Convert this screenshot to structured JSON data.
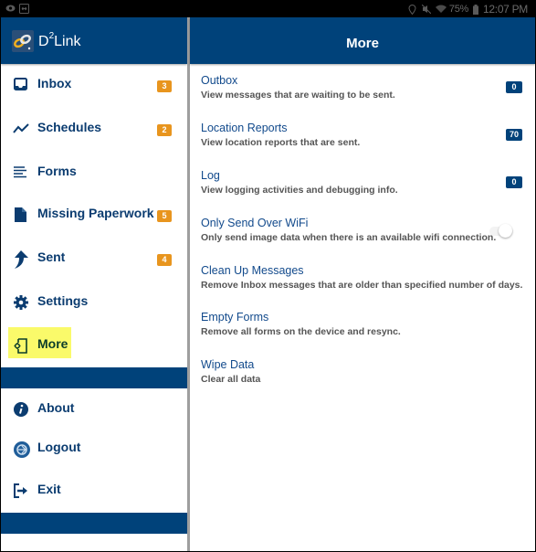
{
  "status_bar": {
    "left_icons": [
      "eye-icon",
      "screen-mirror-icon"
    ],
    "right_icons": [
      "location-icon",
      "mute-icon",
      "wifi-icon",
      "battery-icon"
    ],
    "battery": "75%",
    "time": "12:07 PM"
  },
  "app": {
    "name_prefix": "D",
    "name_sup": "2",
    "name_suffix": "Link"
  },
  "sidebar": {
    "items": [
      {
        "label": "Inbox",
        "icon": "inbox-icon",
        "badge": "3"
      },
      {
        "label": "Schedules",
        "icon": "trending-icon",
        "badge": "2"
      },
      {
        "label": "Forms",
        "icon": "list-lines-icon",
        "badge": null
      },
      {
        "label": "Missing Paperwork",
        "icon": "document-icon",
        "badge": "5"
      },
      {
        "label": "Sent",
        "icon": "sent-arrow-icon",
        "badge": "4"
      },
      {
        "label": "Settings",
        "icon": "gear-icon",
        "badge": null
      },
      {
        "label": "More",
        "icon": "phone-settings-icon",
        "badge": null,
        "active": true
      }
    ],
    "secondary_items": [
      {
        "label": "About",
        "icon": "info-icon"
      },
      {
        "label": "Logout",
        "icon": "logout-icon"
      },
      {
        "label": "Exit",
        "icon": "exit-icon"
      }
    ]
  },
  "main": {
    "title": "More",
    "rows": [
      {
        "title": "Outbox",
        "description": "View messages that are waiting to be sent.",
        "count": "0"
      },
      {
        "title": "Location Reports",
        "description": "View location reports that are sent.",
        "count": "70"
      },
      {
        "title": "Log",
        "description": "View logging activities and debugging info.",
        "count": "0"
      },
      {
        "title": "Only Send Over WiFi",
        "description": "Only send image data when there is an available wifi connection.",
        "toggle": false
      },
      {
        "title": "Clean Up Messages",
        "description": "Remove Inbox messages that are older than specified number of days."
      },
      {
        "title": "Empty Forms",
        "description": "Remove all forms on the device and resync."
      },
      {
        "title": "Wipe Data",
        "description": "Clear all data"
      }
    ]
  },
  "colors": {
    "primary": "#00427a",
    "badge_orange": "#e8951e",
    "highlight": "#fafa6a",
    "nav_text": "#0b3c70",
    "row_title": "#124a8c"
  }
}
